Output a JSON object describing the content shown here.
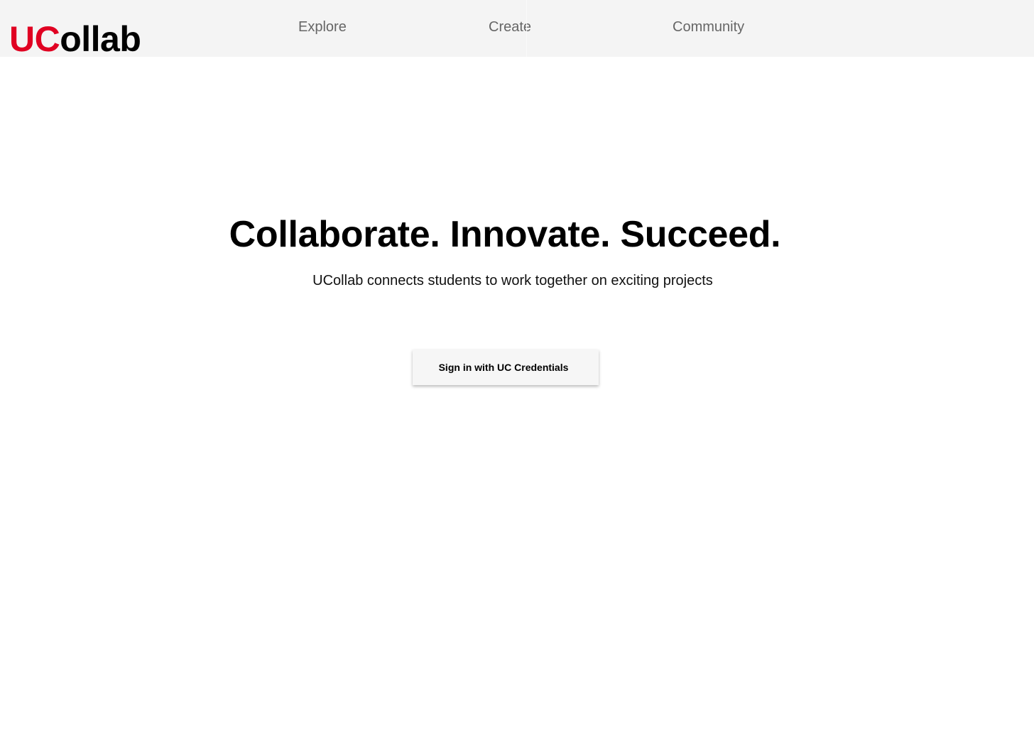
{
  "header": {
    "logo": {
      "accent_text": "UC",
      "rest_text": "ollab",
      "accent_color": "#e00122"
    },
    "nav": {
      "explore": "Explore",
      "create": "Create",
      "community": "Community"
    }
  },
  "hero": {
    "title": "Collaborate. Innovate. Succeed.",
    "subtitle": "UCollab connects students to work together on exciting projects",
    "signin_label": "Sign in with UC Credentials"
  }
}
